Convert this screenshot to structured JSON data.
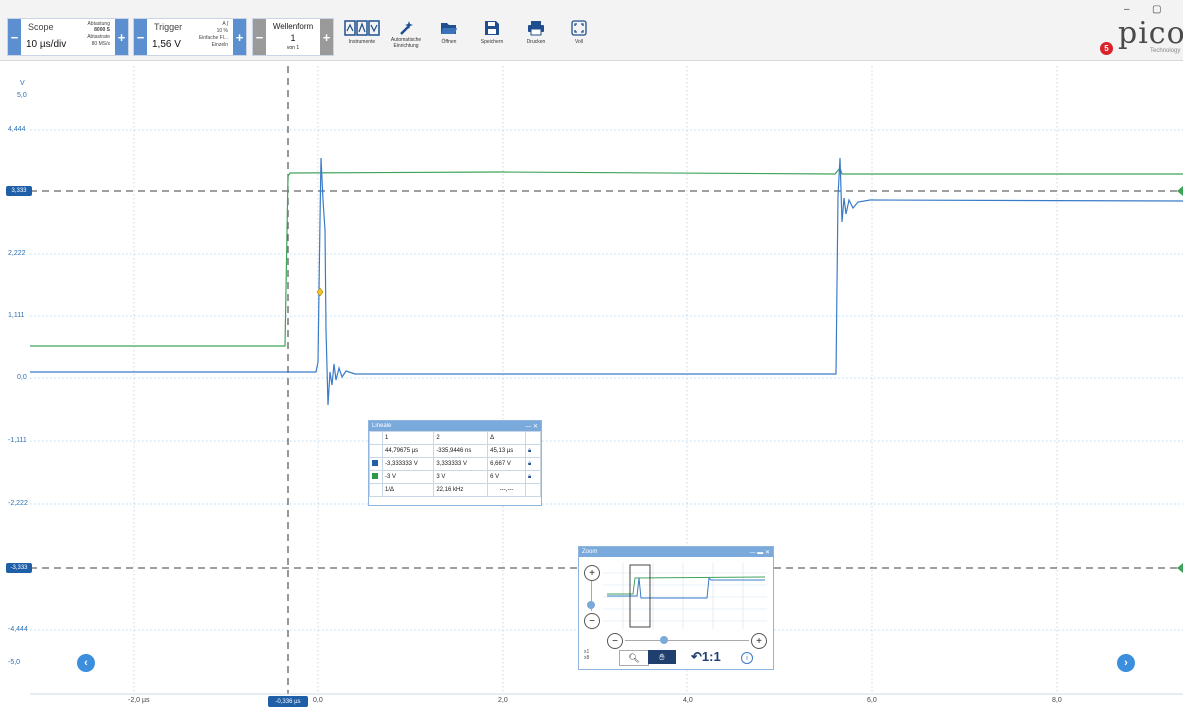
{
  "window": {
    "minimize": "–",
    "restore": "▢"
  },
  "toolbar": {
    "scope": {
      "title": "Scope",
      "value": "10 µs/div",
      "samples_label": "Abtastung",
      "samples_value": "8000 S",
      "rate_label": "Abtastrate",
      "rate_value": "80 MS/s"
    },
    "trigger": {
      "title": "Trigger",
      "value": "1,56 V",
      "channel": "A",
      "percent": "10 %",
      "mode_line1": "Einfache Fl...",
      "mode_line2": "Einzeln"
    },
    "waveform": {
      "title": "Wellenform",
      "value": "1",
      "sub": "von 1"
    },
    "buttons": [
      {
        "label": "Instrumente",
        "icon": "instruments-icon"
      },
      {
        "label": "Automatische\nEinrichtung",
        "icon": "magic-wand-icon"
      },
      {
        "label": "Öffnen",
        "icon": "folder-open-icon"
      },
      {
        "label": "Speichern",
        "icon": "save-icon"
      },
      {
        "label": "Drucken",
        "icon": "print-icon"
      },
      {
        "label": "Voll",
        "icon": "fullscreen-icon"
      }
    ],
    "brand": "pico",
    "brand_sub": "Technology",
    "notification_count": "5"
  },
  "axis": {
    "unit": "V",
    "y_labels": [
      "5,0",
      "4,444",
      "3,333",
      "2,222",
      "1,111",
      "0,0",
      "-1,111",
      "-2,222",
      "-3,333",
      "-4,444",
      "-5,0"
    ],
    "x_labels": [
      "-2,0 µs",
      "0,0",
      "2,0",
      "4,0",
      "6,0",
      "8,0"
    ],
    "cursor_x_readout": "-0,336 µs",
    "ruler_upper": "3,333",
    "ruler_lower": "-3,333"
  },
  "rulers_panel": {
    "title": "Lineale",
    "header": [
      "1",
      "2",
      "Δ"
    ],
    "time_row": [
      "44,79675 µs",
      "-335,9446 ns",
      "45,13 µs"
    ],
    "blue_row": [
      "-3,333333 V",
      "3,333333 V",
      "6,667 V"
    ],
    "green_row": [
      "-3 V",
      "3 V",
      "6 V"
    ],
    "freq_label": "1/Δ",
    "freq_value": "22,16 kHz",
    "freq_extra": "---,---"
  },
  "zoom_panel": {
    "title": "Zoom",
    "level_label": "1:1",
    "zoom_x": "x1",
    "zoom_y": "x8"
  },
  "colors": {
    "blue_channel": "#3a7bc8",
    "green_channel": "#3fa35a",
    "accent": "#2a6fb5"
  }
}
